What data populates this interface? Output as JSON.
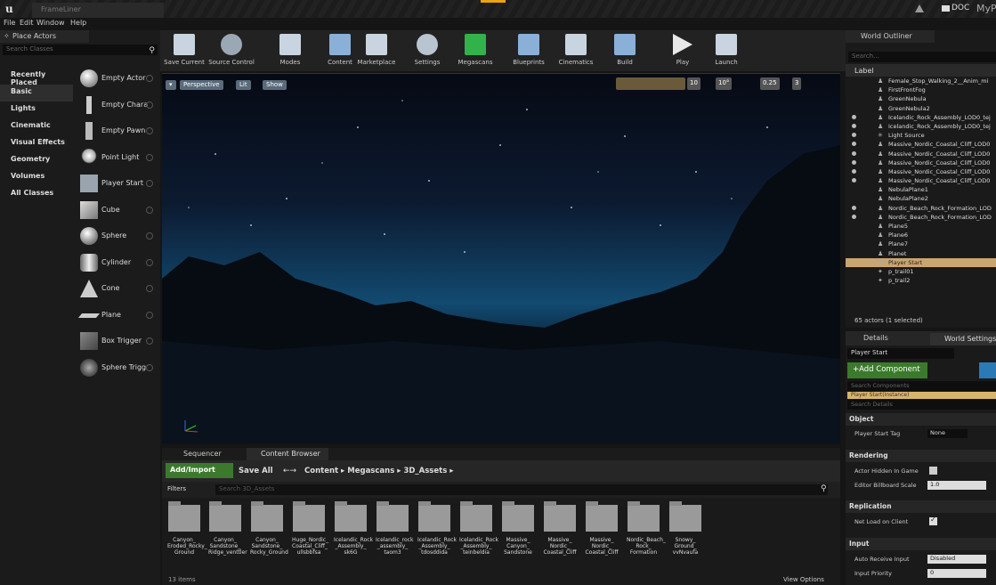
{
  "titlebar": {
    "logo": "u",
    "tab": "FrameLiner",
    "doc": "DOC",
    "project": "MyP"
  },
  "menu": [
    "File",
    "Edit",
    "Window",
    "Help"
  ],
  "place_actors": {
    "title": "Place Actors",
    "search_placeholder": "Search Classes",
    "categories": [
      "Recently Placed",
      "Basic",
      "Lights",
      "Cinematic",
      "Visual Effects",
      "Geometry",
      "Volumes",
      "All Classes"
    ],
    "selected_category": "Basic",
    "items": [
      "Empty Actor",
      "Empty Chara",
      "Empty Pawn",
      "Point Light",
      "Player Start",
      "Cube",
      "Sphere",
      "Cylinder",
      "Cone",
      "Plane",
      "Box Trigger",
      "Sphere Trigg"
    ]
  },
  "toolbar": [
    {
      "label": "Save Current",
      "icon": "save-icon",
      "color": "#c8d4e0"
    },
    {
      "label": "Source Control",
      "icon": "source-control-icon",
      "color": "#c8d4e0"
    },
    {
      "label": "Modes",
      "icon": "modes-icon",
      "color": "#c8d4e0"
    },
    {
      "label": "Content",
      "icon": "content-icon",
      "color": "#8ab0d8"
    },
    {
      "label": "Marketplace",
      "icon": "marketplace-icon",
      "color": "#c8d4e0"
    },
    {
      "label": "Settings",
      "icon": "settings-icon",
      "color": "#c8d4e0"
    },
    {
      "label": "Megascans",
      "icon": "megascans-icon",
      "color": "#32b24a"
    },
    {
      "label": "Blueprints",
      "icon": "blueprints-icon",
      "color": "#8ab0d8"
    },
    {
      "label": "Cinematics",
      "icon": "cinematics-icon",
      "color": "#c8d4e0"
    },
    {
      "label": "Build",
      "icon": "build-icon",
      "color": "#8ab0d8"
    },
    {
      "label": "Play",
      "icon": "play-icon",
      "color": "#e8e8e8"
    },
    {
      "label": "Launch",
      "icon": "launch-icon",
      "color": "#c8d4e0"
    }
  ],
  "viewport": {
    "buttons": [
      "Perspective",
      "Lit",
      "Show"
    ],
    "grid_snap": "10",
    "rot_snap": "10°",
    "scale_snap": "0.25",
    "camera_speed": "3"
  },
  "content_browser": {
    "tabs": [
      "Sequencer",
      "Content Browser"
    ],
    "add_import": "Add/Import",
    "save_all": "Save All",
    "path": [
      "Content",
      "Megascans",
      "3D_Assets"
    ],
    "filters": "Filters",
    "search_placeholder": "Search 3D_Assets",
    "folders": [
      "Canyon_ Eroded_Rocky_ Ground",
      "Canyon_ Sandstone_ Ridge_venttler",
      "Canyon_ Sandstone_ Rocky_Ground",
      "Huge_Nordic_ Coastal_Cliff_ ullsbbfsa",
      "Icelandic_Rock _Assembly_ sk6G",
      "Icelandic_rock _assembly_ taom3",
      "Icelandic_Rock _Assembly_ tdosddida",
      "Icelandic_Rock _Assembly_ teinbeldia",
      "Massive_ Canyon_ Sandstone",
      "Massive_ Nordic_ Coastal_Cliff",
      "Massive_ Nordic_ Coastal_Cliff",
      "Nordic_Beach_ Rock_ Formation",
      "Snowy_ Ground_ vvNvaufa"
    ],
    "count": "13 items",
    "view_options": "View Options"
  },
  "outliner": {
    "title": "World Outliner",
    "search_placeholder": "Search...",
    "label_header": "Label",
    "rows": [
      "Female_Stop_Walking_2__Anim_mi",
      "FirstFrontFog",
      "GreenNebula",
      "GreenNebula2",
      "Icelandic_Rock_Assembly_LOD0_tej",
      "Icelandic_Rock_Assembly_LOD0_tej",
      "Light Source",
      "Massive_Nordic_Coastal_Cliff_LOD0",
      "Massive_Nordic_Coastal_Cliff_LOD0",
      "Massive_Nordic_Coastal_Cliff_LOD0",
      "Massive_Nordic_Coastal_Cliff_LOD0",
      "Massive_Nordic_Coastal_Cliff_LOD0",
      "NebulaPlane1",
      "NebulaPlane2",
      "Nordic_Beach_Rock_Formation_LOD",
      "Nordic_Beach_Rock_Formation_LOD",
      "Plane5",
      "Plane6",
      "Plane7",
      "Planet",
      "Player Start",
      "p_trail01",
      "p_trail2"
    ],
    "selected": "Player Start",
    "count": "65 actors (1 selected)"
  },
  "details": {
    "tabs": [
      "Details",
      "World Settings"
    ],
    "name": "Player Start",
    "add_component": "+Add Component",
    "search_components": "Search Components",
    "instance": "Player Start(Instance)",
    "search_details": "Search Details",
    "sections": [
      {
        "name": "Object",
        "props": [
          {
            "label": "Player Start Tag",
            "value": "None",
            "kind": "text"
          }
        ]
      },
      {
        "name": "Rendering",
        "props": [
          {
            "label": "Actor Hidden In Game",
            "value": "",
            "kind": "check"
          },
          {
            "label": "Editor Billboard Scale",
            "value": "1.0",
            "kind": "spin"
          }
        ]
      },
      {
        "name": "Replication",
        "props": [
          {
            "label": "Net Load on Client",
            "value": "true",
            "kind": "checked"
          }
        ]
      },
      {
        "name": "Input",
        "props": [
          {
            "label": "Auto Receive Input",
            "value": "Disabled",
            "kind": "dropdown"
          },
          {
            "label": "Input Priority",
            "value": "0",
            "kind": "spin"
          }
        ]
      }
    ]
  }
}
